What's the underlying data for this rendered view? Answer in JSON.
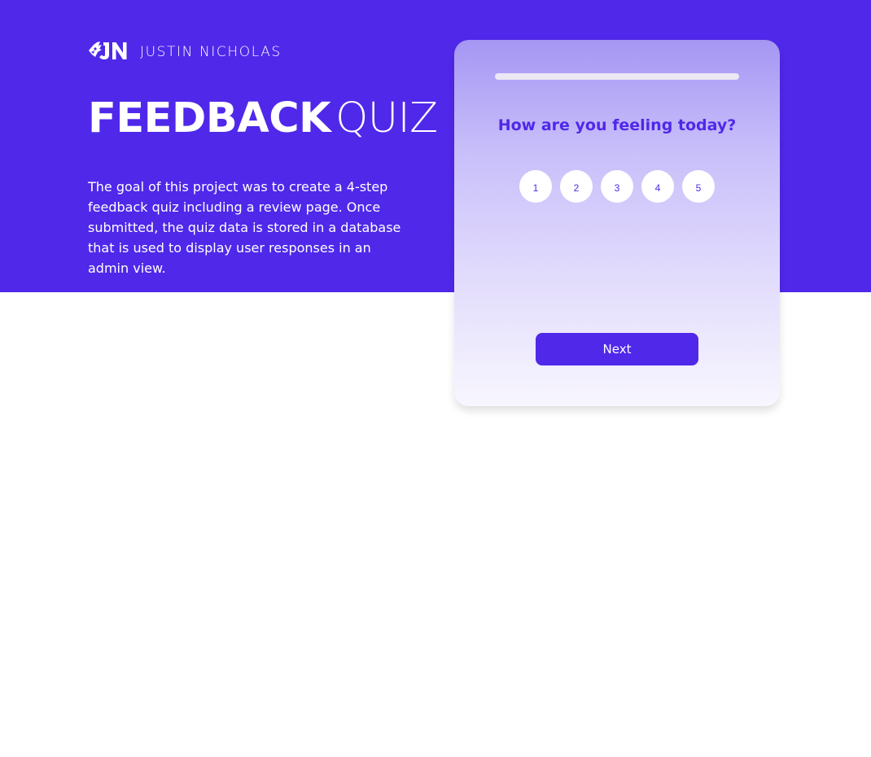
{
  "brand": {
    "logo_icon": "jn-monogram-logo",
    "name": "JUSTIN NICHOLAS"
  },
  "hero": {
    "title_bold": "FEEDBACK",
    "title_light": "QUIZ",
    "description": "The goal of this project was to create a 4-step feedback quiz including a review page. Once submitted, the quiz data is stored in a database that is used to display user responses in an admin view."
  },
  "quiz": {
    "progress": 0,
    "question": "How are you feeling today?",
    "ratings": [
      "1",
      "2",
      "3",
      "4",
      "5"
    ],
    "next_label": "Next"
  },
  "colors": {
    "brand_purple": "#4f28ea",
    "white": "#ffffff",
    "card_top": "#a596f3",
    "card_bottom": "#f8f6fe",
    "progress_track": "#ebe8f4"
  }
}
